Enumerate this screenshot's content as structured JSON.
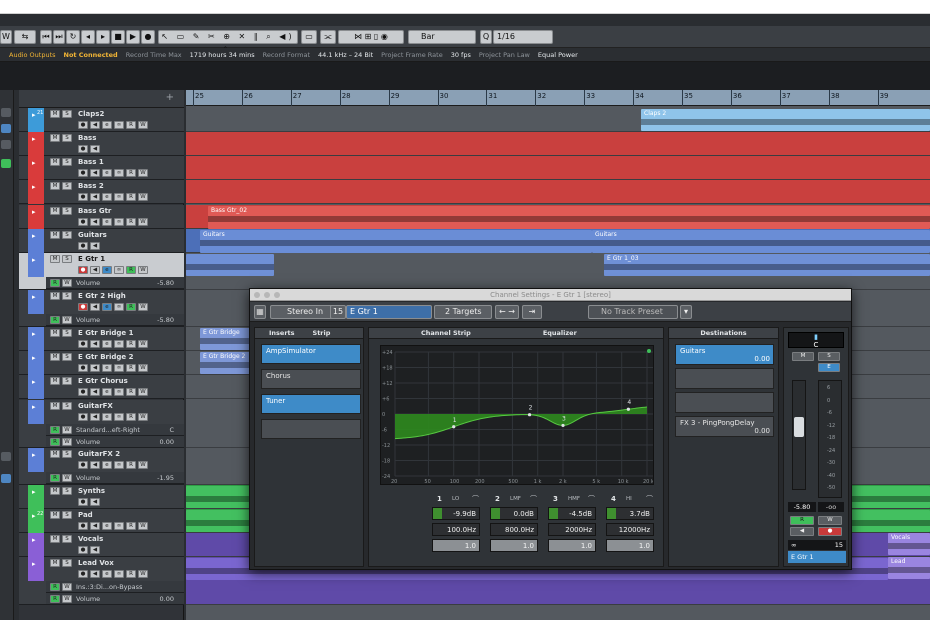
{
  "status": {
    "audio_outputs_label": "Audio Outputs",
    "audio_outputs_value": "Not Connected",
    "record_time_label": "Record Time Max",
    "record_time_value": "1719 hours 34 mins",
    "record_format_label": "Record Format",
    "record_format_value": "44.1 kHz – 24 Bit",
    "frame_rate_label": "Project Frame Rate",
    "frame_rate_value": "30 fps",
    "pan_law_label": "Project Pan Law",
    "pan_law_value": "Equal Power"
  },
  "toolbar": {
    "snap_type": "Bar",
    "quantize": "1/16",
    "quantize_prefix": "Q",
    "w_label": "W"
  },
  "ruler": {
    "bars": [
      "25",
      "26",
      "27",
      "28",
      "29",
      "30",
      "31",
      "32",
      "33",
      "34",
      "35",
      "36",
      "37",
      "38",
      "39"
    ]
  },
  "tracks": [
    {
      "name": "Claps2",
      "color": "#3d9bd9",
      "num": "21"
    },
    {
      "name": "Bass",
      "color": "#d93b3b"
    },
    {
      "name": "Bass 1",
      "color": "#d93b3b"
    },
    {
      "name": "Bass 2",
      "color": "#d93b3b"
    },
    {
      "name": "Bass Gtr",
      "color": "#d93b3b"
    },
    {
      "name": "Guitars",
      "color": "#5c7fd6"
    },
    {
      "name": "E Gtr 1",
      "color": "#5c7fd6",
      "sub": "Volume",
      "sub_val": "-5.80"
    },
    {
      "name": "E Gtr 2 High",
      "color": "#5c7fd6",
      "sub": "Volume",
      "sub_val": "-5.80"
    },
    {
      "name": "E Gtr Bridge 1",
      "color": "#5c7fd6"
    },
    {
      "name": "E Gtr Bridge 2",
      "color": "#5c7fd6"
    },
    {
      "name": "E Gtr Chorus",
      "color": "#5c7fd6"
    },
    {
      "name": "GuitarFX",
      "color": "#5c7fd6",
      "sub": "Standard...eft-Right",
      "sub_val": "C",
      "sub2": "Volume",
      "sub2_val": "0.00"
    },
    {
      "name": "GuitarFX 2",
      "color": "#5c7fd6",
      "sub": "Volume",
      "sub_val": "-1.95"
    },
    {
      "name": "Synths",
      "color": "#3fbf5a"
    },
    {
      "name": "Pad",
      "color": "#3fbf5a",
      "num": "22"
    },
    {
      "name": "Vocals",
      "color": "#8a5fd6"
    },
    {
      "name": "Lead Vox",
      "color": "#8a5fd6",
      "sub": "Ins.:3:Di...on-Bypass",
      "sub2": "Volume",
      "sub2_val": "0.00"
    }
  ],
  "clips": {
    "claps": "Claps 2",
    "bass_gtr": "Bass Gtr_02",
    "guitars_a": "Guitars",
    "guitars_b": "Guitars",
    "egtr1_03": "E Gtr 1_03",
    "bridge1": "E Gtr Bridge",
    "bridge2": "E Gtr Bridge 2",
    "vocals": "Vocals",
    "lead": "Lead"
  },
  "channel_settings": {
    "title": "Channel Settings - E Gtr 1 [stereo]",
    "input": "Stereo In",
    "channel_num": "15",
    "channel_name": "E Gtr 1",
    "targets": "2 Targets",
    "preset": "No Track Preset",
    "tab_inserts": "Inserts",
    "tab_strip": "Strip",
    "tab_channel_strip": "Channel Strip",
    "tab_equalizer": "Equalizer",
    "tab_destinations": "Destinations",
    "inserts": [
      "AmpSimulator",
      "Chorus",
      "Tuner",
      ""
    ],
    "eq_ylabels": [
      "+24",
      "+18",
      "+12",
      "+6",
      "0",
      "-6",
      "-12",
      "-18",
      "-24"
    ],
    "eq_xlabels": [
      "20",
      "50",
      "100",
      "200",
      "500",
      "1 k",
      "2 k",
      "5 k",
      "10 k",
      "20 k"
    ],
    "bands": [
      {
        "num": "1",
        "type": "LO",
        "gain": "-9.9dB",
        "freq": "100.0Hz",
        "q": "1.0"
      },
      {
        "num": "2",
        "type": "LMF",
        "gain": "0.0dB",
        "freq": "800.0Hz",
        "q": "1.0"
      },
      {
        "num": "3",
        "type": "HMF",
        "gain": "-4.5dB",
        "freq": "2000Hz",
        "q": "1.0"
      },
      {
        "num": "4",
        "type": "HI",
        "gain": "3.7dB",
        "freq": "12000Hz",
        "q": "1.0"
      }
    ],
    "destinations": [
      {
        "name": "Guitars",
        "value": "0.00"
      },
      {
        "name": "",
        "value": ""
      },
      {
        "name": "",
        "value": ""
      },
      {
        "name": "FX 3 - PingPongDelay",
        "value": "0.00"
      }
    ],
    "pan": "C",
    "fader_value": "-5.80",
    "fader_peak": "-oo",
    "meter_scale": [
      "6",
      "0",
      "-6",
      "-12",
      "-18",
      "-24",
      "-30",
      "-40",
      "-50"
    ],
    "bottom_num": "15",
    "bottom_name": "E Gtr 1",
    "m": "M",
    "s": "S",
    "e": "E",
    "r": "R",
    "w": "W"
  },
  "colors": {
    "bass": "#d93b3b",
    "guitar": "#5c7fd6",
    "synth": "#3fbf5a",
    "vocal": "#8a5fd6",
    "claps": "#3d9bd9",
    "eq_fill": "#2e8a1e",
    "accent": "#3e8bc8"
  }
}
